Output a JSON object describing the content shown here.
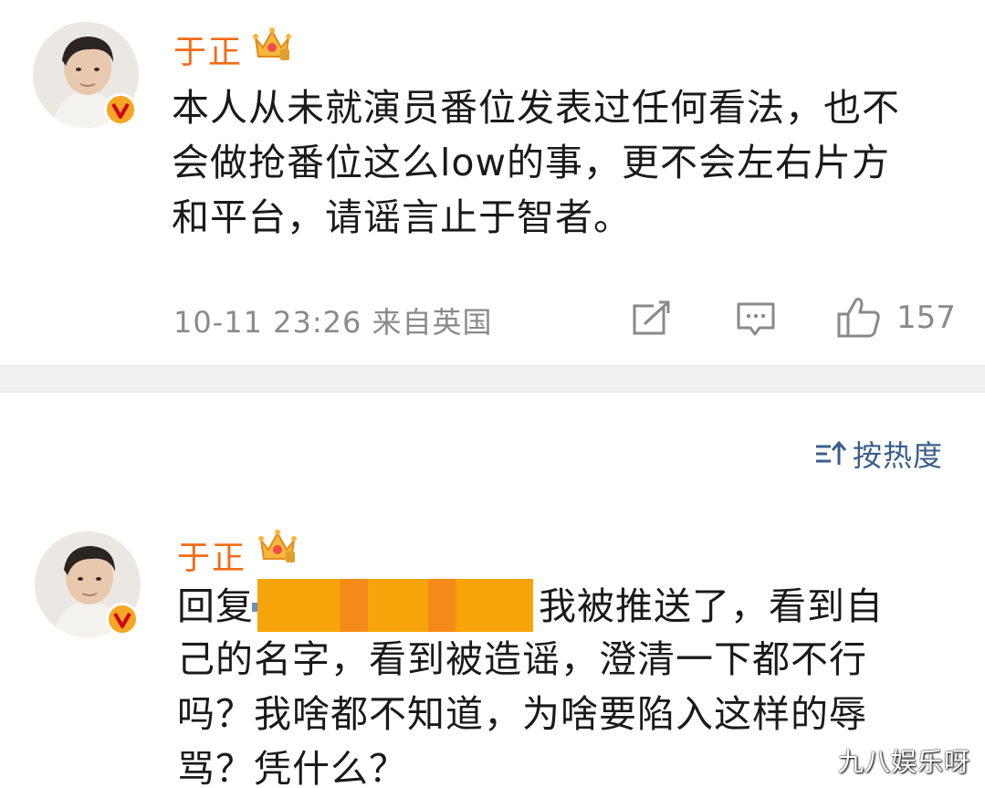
{
  "post": {
    "username": "于正",
    "text_lines": [
      "本人从未就演员番位发表过任何看法，也不",
      "会做抢番位这么low的事，更不会左右片方",
      "和平台，请谣言止于智者。"
    ],
    "meta": "10-11 23:26 来自英国",
    "likes": "157"
  },
  "sort": {
    "label": "按热度"
  },
  "reply": {
    "username": "于正",
    "prefix": "回复",
    "line1_tail": "我被推送了，看到自",
    "text_lines": [
      "己的名字，看到被造谣，澄清一下都不行",
      "吗？我啥都不知道，为啥要陷入这样的辱",
      "骂？凭什么？"
    ]
  },
  "watermark": "九八娱乐呀",
  "colors": {
    "username": "#f26b16",
    "badge": "#f5a623",
    "sort": "#3a5f8a",
    "meta": "#8a8a8a"
  },
  "icons": [
    "crown-icon",
    "verified-badge-icon",
    "share-icon",
    "comment-icon",
    "like-icon",
    "sort-icon"
  ]
}
